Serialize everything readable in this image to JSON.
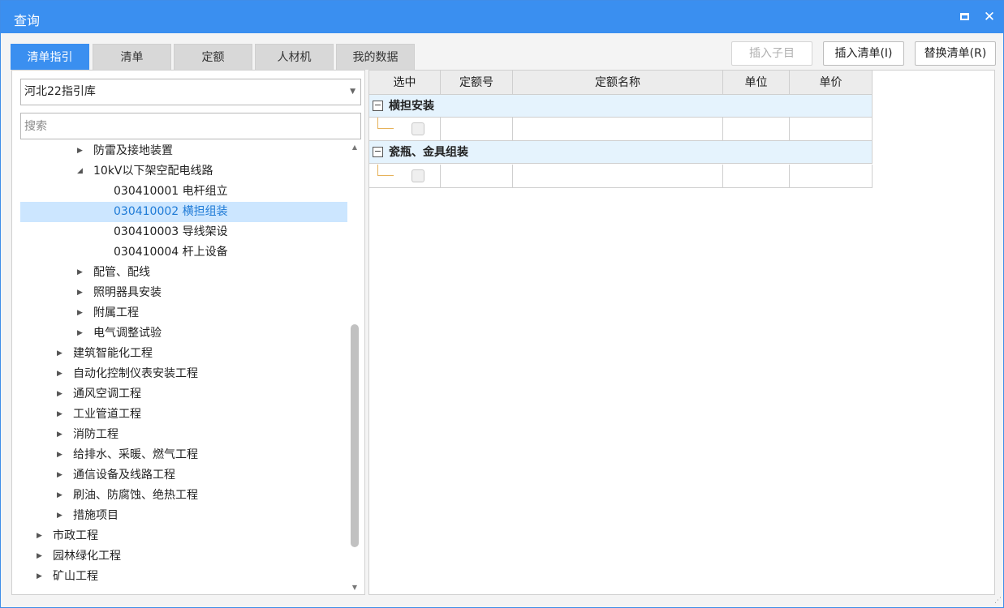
{
  "window": {
    "title": "查询"
  },
  "tabs": [
    {
      "label": "清单指引",
      "active": true
    },
    {
      "label": "清单",
      "active": false
    },
    {
      "label": "定额",
      "active": false
    },
    {
      "label": "人材机",
      "active": false
    },
    {
      "label": "我的数据",
      "active": false
    }
  ],
  "toolbar": {
    "insert_child": "插入子目",
    "insert_list": "插入清单(I)",
    "replace_list": "替换清单(R)"
  },
  "library": {
    "selected": "河北22指引库"
  },
  "search": {
    "placeholder": "搜索",
    "value": ""
  },
  "tree": [
    {
      "label": "防雷及接地装置",
      "level": 2,
      "expander": "collapsed",
      "selected": false
    },
    {
      "label": "10kV以下架空配电线路",
      "level": 2,
      "expander": "expanded",
      "selected": false
    },
    {
      "label": "030410001  电杆组立",
      "level": 3,
      "expander": "none",
      "selected": false
    },
    {
      "label": "030410002  横担组装",
      "level": 3,
      "expander": "none",
      "selected": true
    },
    {
      "label": "030410003  导线架设",
      "level": 3,
      "expander": "none",
      "selected": false
    },
    {
      "label": "030410004  杆上设备",
      "level": 3,
      "expander": "none",
      "selected": false
    },
    {
      "label": "配管、配线",
      "level": 2,
      "expander": "collapsed",
      "selected": false
    },
    {
      "label": "照明器具安装",
      "level": 2,
      "expander": "collapsed",
      "selected": false
    },
    {
      "label": "附属工程",
      "level": 2,
      "expander": "collapsed",
      "selected": false
    },
    {
      "label": "电气调整试验",
      "level": 2,
      "expander": "collapsed",
      "selected": false
    },
    {
      "label": "建筑智能化工程",
      "level": 1,
      "expander": "collapsed",
      "selected": false
    },
    {
      "label": "自动化控制仪表安装工程",
      "level": 1,
      "expander": "collapsed",
      "selected": false
    },
    {
      "label": "通风空调工程",
      "level": 1,
      "expander": "collapsed",
      "selected": false
    },
    {
      "label": "工业管道工程",
      "level": 1,
      "expander": "collapsed",
      "selected": false
    },
    {
      "label": "消防工程",
      "level": 1,
      "expander": "collapsed",
      "selected": false
    },
    {
      "label": "给排水、采暖、燃气工程",
      "level": 1,
      "expander": "collapsed",
      "selected": false
    },
    {
      "label": "通信设备及线路工程",
      "level": 1,
      "expander": "collapsed",
      "selected": false
    },
    {
      "label": "刷油、防腐蚀、绝热工程",
      "level": 1,
      "expander": "collapsed",
      "selected": false
    },
    {
      "label": "措施项目",
      "level": 1,
      "expander": "collapsed",
      "selected": false
    },
    {
      "label": "市政工程",
      "level": 0,
      "expander": "collapsed",
      "selected": false
    },
    {
      "label": "园林绿化工程",
      "level": 0,
      "expander": "collapsed",
      "selected": false
    },
    {
      "label": "矿山工程",
      "level": 0,
      "expander": "collapsed",
      "selected": false
    }
  ],
  "grid": {
    "columns": [
      "选中",
      "定额号",
      "定额名称",
      "单位",
      "单价"
    ],
    "groups": [
      {
        "label": "横担安装"
      },
      {
        "label": "瓷瓶、金具组装"
      }
    ]
  },
  "icons": {
    "maximize": "maximize-icon",
    "close": "close-icon",
    "expand": "triangle-right-icon",
    "collapse": "triangle-down-icon",
    "dropdown": "chevron-down-icon"
  },
  "colors": {
    "accent": "#3a8ff0",
    "selected_bg": "#cce6ff",
    "selected_text": "#1e7ad6",
    "group_bg": "#e5f3fd"
  }
}
